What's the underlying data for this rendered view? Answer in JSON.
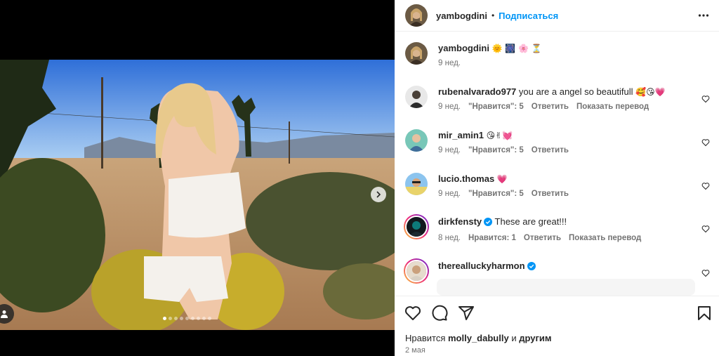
{
  "post": {
    "author": "yambogdini",
    "follow_label": "Подписаться",
    "caption_emojis": "🌞 🎆 🌸 ⏳",
    "caption_time": "9 нед.",
    "carousel_total": 9,
    "carousel_current": 1
  },
  "comments": [
    {
      "user": "rubenalvarado977",
      "text": "you are a angel so beautifull",
      "emojis": "🥰😘💗",
      "time": "9 нед.",
      "likes": "\"Нравится\": 5",
      "reply": "Ответить",
      "translate": "Показать перевод",
      "verified": false
    },
    {
      "user": "mir_amin1",
      "text": "",
      "emojis": "😘✌💓",
      "time": "9 нед.",
      "likes": "\"Нравится\": 5",
      "reply": "Ответить",
      "translate": "",
      "verified": false
    },
    {
      "user": "lucio.thomas",
      "text": "",
      "emojis": "💗",
      "time": "9 нед.",
      "likes": "\"Нравится\": 5",
      "reply": "Ответить",
      "translate": "",
      "verified": false
    },
    {
      "user": "dirkfensty",
      "text": "These are great!!!",
      "emojis": "",
      "time": "8 нед.",
      "likes": "Нравится: 1",
      "reply": "Ответить",
      "translate": "Показать перевод",
      "verified": true
    },
    {
      "user": "therealluckyharmon",
      "text": "",
      "emojis": "",
      "time": "",
      "likes": "",
      "reply": "",
      "translate": "",
      "verified": true
    }
  ],
  "footer": {
    "likes_prefix": "Нравится",
    "likes_user": "molly_dabully",
    "likes_conj": "и",
    "likes_others": "другим",
    "date": "2 мая"
  },
  "colors": {
    "accent": "#0095f6",
    "heart_pink": "#ff3b7a",
    "muted": "#737373"
  },
  "icons": [
    "more-icon",
    "heart-icon",
    "comment-icon",
    "share-icon",
    "bookmark-icon",
    "chevron-right-icon",
    "user-tag-icon",
    "verified-icon"
  ]
}
